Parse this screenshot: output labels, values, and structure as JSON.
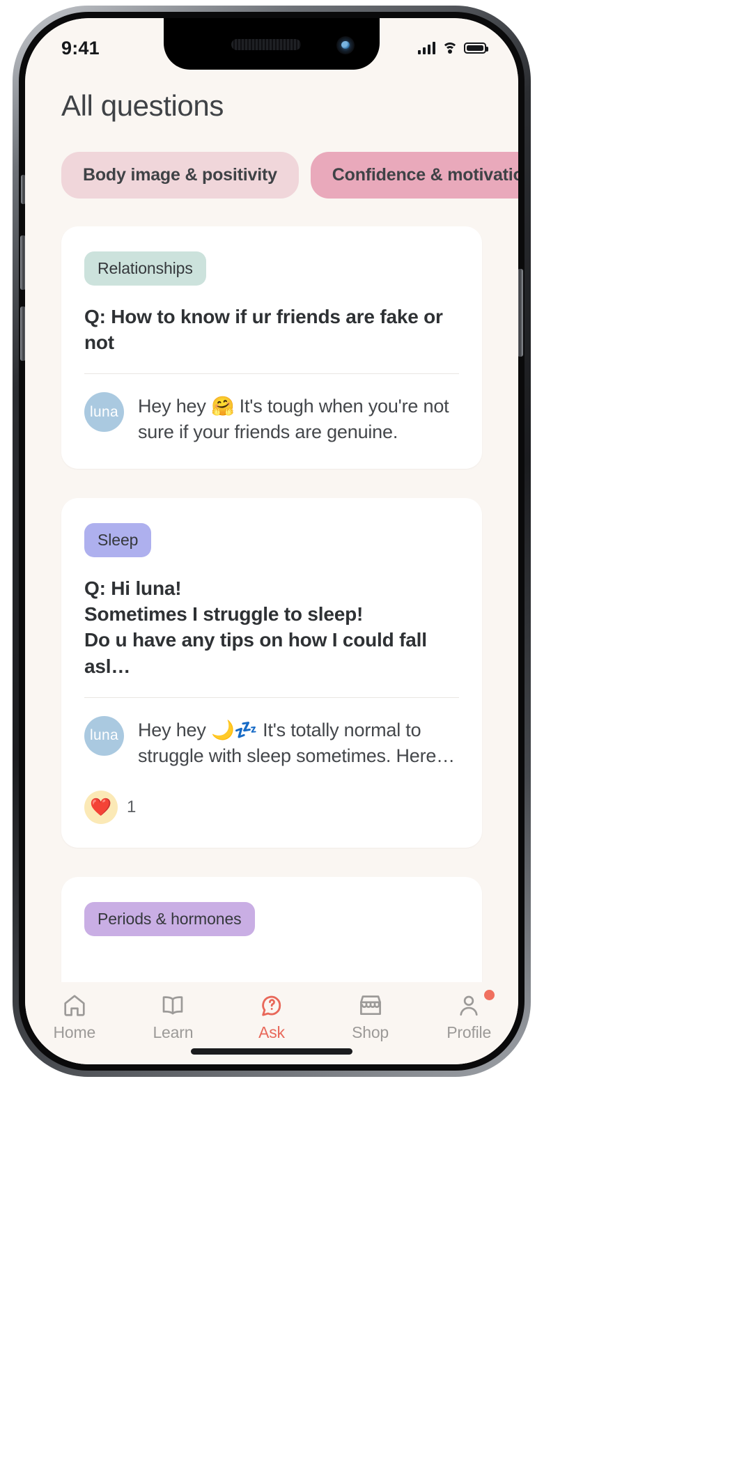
{
  "status_bar": {
    "time": "9:41",
    "signal_icon": "cellular-signal-icon",
    "wifi_icon": "wifi-icon",
    "battery_icon": "battery-full-icon"
  },
  "header": {
    "title": "All questions"
  },
  "filters": {
    "chips": [
      {
        "label": "Body image & positivity",
        "bg": "#f0d6da",
        "selected": false
      },
      {
        "label": "Confidence & motivation",
        "bg": "#e9a9bb",
        "selected": true
      }
    ]
  },
  "feed": {
    "cards": [
      {
        "tag": "Relationships",
        "tag_bg": "#cce2dc",
        "question_lines": [
          "Q: How to know if ur friends are fake or",
          "not"
        ],
        "answer": {
          "avatar_label": "luna",
          "avatar_bg": "#aac9e0",
          "text": "Hey hey 🤗 It's tough when you're not sure if your friends are genuine."
        },
        "reactions": []
      },
      {
        "tag": "Sleep",
        "tag_bg": "#aeb0ee",
        "question_lines": [
          "Q: Hi luna!",
          "Sometimes I struggle to sleep!",
          "Do u have any tips on how I could fall asl…"
        ],
        "answer": {
          "avatar_label": "luna",
          "avatar_bg": "#aac9e0",
          "text": "Hey hey 🌙💤 It's totally normal to struggle with sleep sometimes. Here…"
        },
        "reactions": [
          {
            "emoji": "❤️",
            "count": "1",
            "bg": "#fbe9b6"
          }
        ]
      },
      {
        "tag": "Periods & hormones",
        "tag_bg": "#c9aee4",
        "question_lines": [],
        "answer": null,
        "reactions": []
      }
    ]
  },
  "tabbar": {
    "items": [
      {
        "label": "Home",
        "icon": "home-icon",
        "active": false,
        "badge": false
      },
      {
        "label": "Learn",
        "icon": "book-icon",
        "active": false,
        "badge": false
      },
      {
        "label": "Ask",
        "icon": "chat-ask-icon",
        "active": true,
        "badge": false
      },
      {
        "label": "Shop",
        "icon": "store-icon",
        "active": false,
        "badge": false
      },
      {
        "label": "Profile",
        "icon": "person-icon",
        "active": false,
        "badge": true
      }
    ],
    "active_color": "#e8685a",
    "inactive_color": "#9c9a98",
    "badge_color": "#f0705f"
  }
}
